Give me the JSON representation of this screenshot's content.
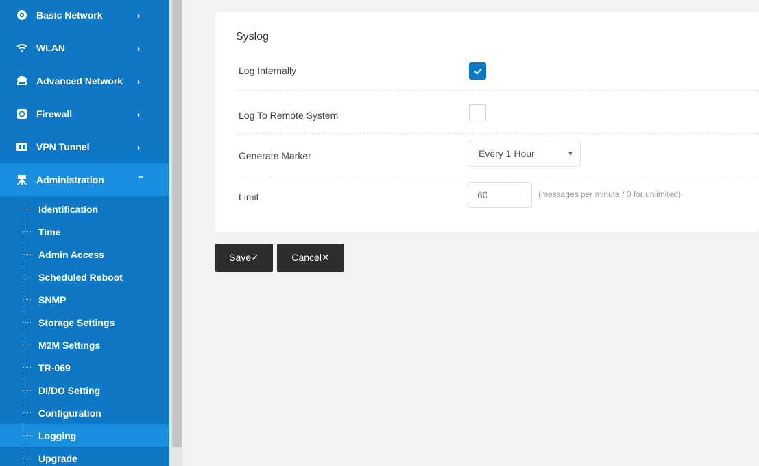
{
  "sidebar": {
    "nav": [
      {
        "label": "Basic Network",
        "icon": "globe-icon",
        "chevron": "›"
      },
      {
        "label": "WLAN",
        "icon": "wifi-icon",
        "chevron": "›"
      },
      {
        "label": "Advanced Network",
        "icon": "network-icon",
        "chevron": "›"
      },
      {
        "label": "Firewall",
        "icon": "firewall-icon",
        "chevron": "›"
      },
      {
        "label": "VPN Tunnel",
        "icon": "vpn-icon",
        "chevron": "›"
      },
      {
        "label": "Administration",
        "icon": "admin-icon",
        "chevron": "⌄"
      }
    ],
    "sub_items": [
      "Identification",
      "Time",
      "Admin Access",
      "Scheduled Reboot",
      "SNMP",
      "Storage Settings",
      "M2M Settings",
      "TR-069",
      "DI/DO Setting",
      "Configuration",
      "Logging",
      "Upgrade"
    ],
    "active_sub": "Logging"
  },
  "syslog": {
    "title": "Syslog",
    "log_internally": {
      "label": "Log Internally",
      "checked": true
    },
    "log_remote": {
      "label": "Log To Remote System",
      "checked": false
    },
    "generate_marker": {
      "label": "Generate Marker",
      "value": "Every 1 Hour"
    },
    "limit": {
      "label": "Limit",
      "value": "60",
      "hint": "(messages per minute / 0 for unlimited)"
    }
  },
  "buttons": {
    "save": "Save✓",
    "cancel": "Cancel✕"
  },
  "colors": {
    "sidebar": "#0e78c6",
    "active": "#1a8fe0",
    "button": "#2d2d2d"
  }
}
